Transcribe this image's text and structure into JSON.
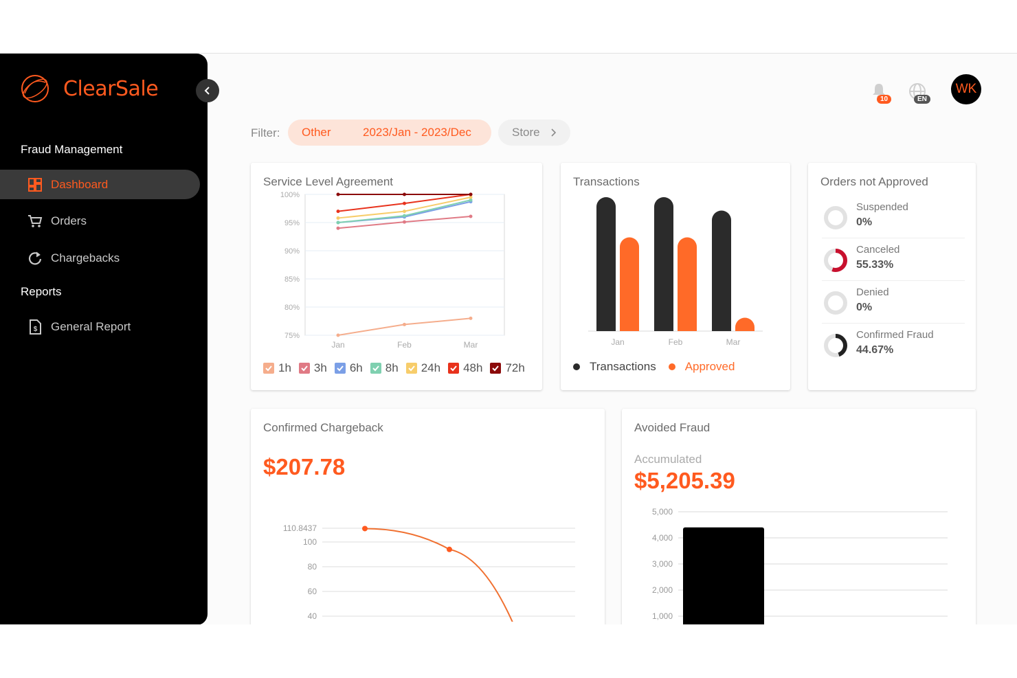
{
  "brand": {
    "name": "ClearSale",
    "accent": "#ff5a1f",
    "logo_icon": "orbit-logo-icon"
  },
  "sidebar": {
    "collapse_icon": "chevron-left-icon",
    "sections": [
      {
        "title": "Fraud Management"
      },
      {
        "title": "Reports"
      }
    ],
    "items": [
      {
        "label": "Dashboard",
        "icon": "dashboard-grid-icon",
        "active": true
      },
      {
        "label": "Orders",
        "icon": "cart-icon"
      },
      {
        "label": "Chargebacks",
        "icon": "refresh-icon"
      },
      {
        "label": "General Report",
        "icon": "document-dollar-icon"
      }
    ]
  },
  "header": {
    "notifications": {
      "icon": "bell-icon",
      "count": "10"
    },
    "language": {
      "icon": "globe-icon",
      "code": "EN"
    },
    "avatar": {
      "initials": "WK"
    }
  },
  "filter": {
    "label": "Filter:",
    "type_value": "Other",
    "date_range": "2023/Jan - 2023/Dec",
    "store_label": "Store",
    "store_icon": "chevron-right-icon"
  },
  "cards": {
    "sla": {
      "title": "Service Level Agreement"
    },
    "transactions": {
      "title": "Transactions"
    },
    "orders_not_approved": {
      "title": "Orders not Approved",
      "items": [
        {
          "label": "Suspended",
          "value": "0%",
          "fraction": 0
        },
        {
          "label": "Canceled",
          "value": "55.33%",
          "fraction": 0.5533
        },
        {
          "label": "Denied",
          "value": "0%",
          "fraction": 0
        },
        {
          "label": "Confirmed Fraud",
          "value": "44.67%",
          "fraction": 0.4467
        }
      ]
    },
    "confirmed_chargeback": {
      "title": "Confirmed Chargeback",
      "value": "$207.78"
    },
    "avoided_fraud": {
      "title": "Avoided Fraud",
      "subtitle": "Accumulated",
      "value": "$5,205.39"
    }
  },
  "chart_data": [
    {
      "type": "line",
      "title": "Service Level Agreement",
      "categories": [
        "Jan",
        "Feb",
        "Mar"
      ],
      "yticks": [
        "100%",
        "95%",
        "90%",
        "85%",
        "80%",
        "75%"
      ],
      "ylim": [
        75,
        100
      ],
      "grid": true,
      "legend": "bottom",
      "series": [
        {
          "name": "1h",
          "color": "#f5ad8c",
          "values": [
            75,
            76.9,
            78
          ]
        },
        {
          "name": "3h",
          "color": "#e07a85",
          "values": [
            94,
            95.1,
            96.1
          ]
        },
        {
          "name": "6h",
          "color": "#7b9fe6",
          "values": [
            95,
            96,
            98.7
          ]
        },
        {
          "name": "8h",
          "color": "#7fd0b0",
          "values": [
            95,
            96.2,
            99
          ]
        },
        {
          "name": "24h",
          "color": "#f7cd6b",
          "values": [
            95.8,
            97,
            99.5
          ]
        },
        {
          "name": "48h",
          "color": "#e8321c",
          "values": [
            97,
            98.4,
            100
          ]
        },
        {
          "name": "72h",
          "color": "#8b0a0a",
          "values": [
            100,
            100,
            100
          ]
        }
      ]
    },
    {
      "type": "bar",
      "title": "Transactions",
      "categories": [
        "Jan",
        "Feb",
        "Mar"
      ],
      "ylim": [
        0,
        100
      ],
      "legend": "bottom",
      "series": [
        {
          "name": "Transactions",
          "color": "#2b2b2b",
          "values": [
            100,
            100,
            90
          ]
        },
        {
          "name": "Approved",
          "color": "#ff6a28",
          "values": [
            70,
            70,
            10
          ]
        }
      ]
    },
    {
      "type": "line",
      "title": "Confirmed Chargeback",
      "yticks": [
        "110.8437",
        "100",
        "80",
        "60",
        "40"
      ],
      "ylim": [
        40,
        110.8437
      ],
      "grid": true,
      "series": [
        {
          "color": "#f07030",
          "values": [
            110.8437,
            94,
            40
          ]
        }
      ]
    },
    {
      "type": "bar",
      "title": "Avoided Fraud",
      "yticks": [
        "5,000",
        "4,000",
        "3,000",
        "2,000",
        "1,000"
      ],
      "ylim": [
        0,
        5000
      ],
      "grid": true,
      "series": [
        {
          "color": "#000000",
          "values": [
            4400
          ]
        }
      ]
    }
  ]
}
